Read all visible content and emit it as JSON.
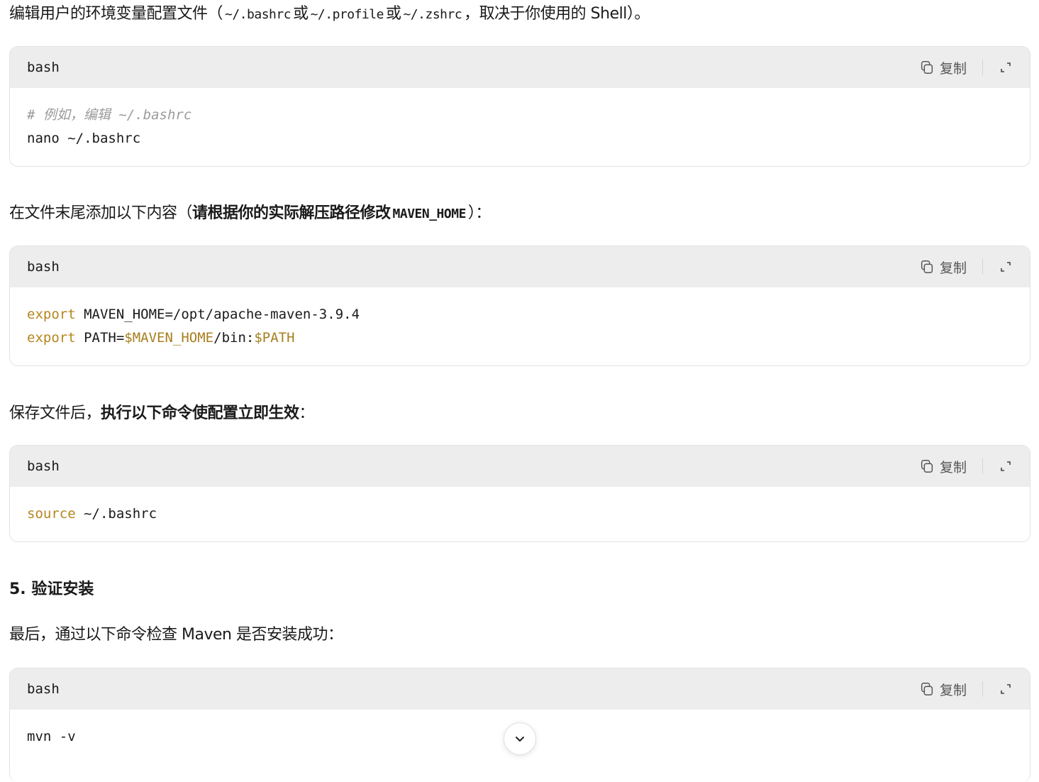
{
  "p1": {
    "text_a": "编辑用户的环境变量配置文件（",
    "code_a": "~/.bashrc",
    "text_b": "或",
    "code_b": "~/.profile",
    "text_c": "或",
    "code_c": "~/.zshrc",
    "text_d": "，取决于你使用的 Shell）。"
  },
  "block1": {
    "lang": "bash",
    "copy_label": "复制",
    "comment": "# 例如，编辑 ~/.bashrc",
    "line2": "nano ~/.bashrc"
  },
  "p2": {
    "text_a": "在文件末尾添加以下内容（",
    "bold": "请根据你的实际解压路径修改",
    "code": "MAVEN_HOME",
    "text_b": "）："
  },
  "block2": {
    "lang": "bash",
    "copy_label": "复制",
    "line1_kw": "export",
    "line1_rest": " MAVEN_HOME=/opt/apache-maven-3.9.4",
    "line2_kw": "export",
    "line2_a": " PATH=",
    "line2_var1": "$MAVEN_HOME",
    "line2_b": "/bin:",
    "line2_var2": "$PATH"
  },
  "p3": {
    "text_a": "保存文件后，",
    "bold": "执行以下命令使配置立即生效",
    "text_b": "："
  },
  "block3": {
    "lang": "bash",
    "copy_label": "复制",
    "kw": "source",
    "rest": " ~/.bashrc"
  },
  "heading5": "5. 验证安装",
  "p4": "最后，通过以下命令检查 Maven 是否安装成功：",
  "block4": {
    "lang": "bash",
    "copy_label": "复制",
    "line1": "mvn -v"
  },
  "icons": {
    "copy": "copy-icon",
    "expand": "expand-icon",
    "scroll": "chevron-down-icon"
  },
  "colors": {
    "keyword": "#b5861f",
    "variable": "#a77f1e",
    "comment": "#9a9a9a",
    "header_bg": "#ededed"
  }
}
